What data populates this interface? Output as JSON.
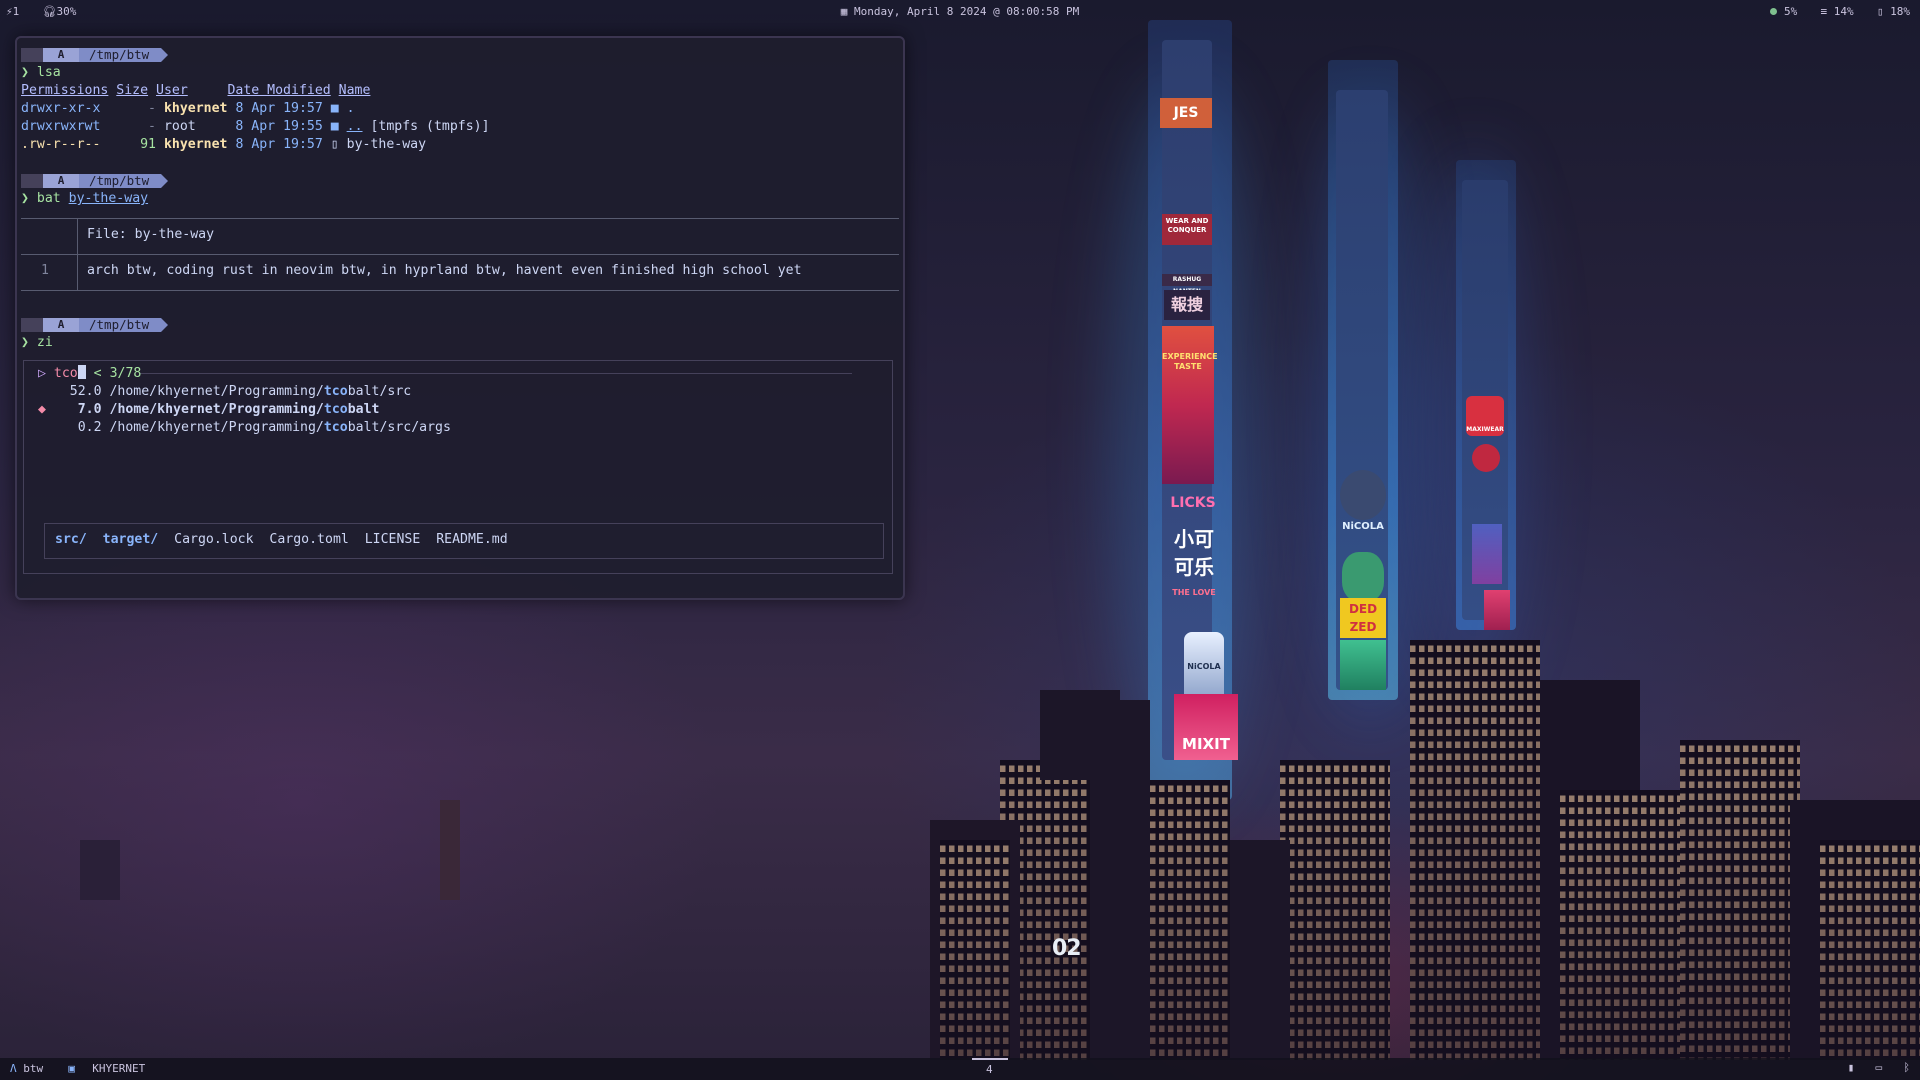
{
  "topbar": {
    "workspace": "1",
    "volume": "30%",
    "datetime": "Monday, April  8 2024 @ 08:00:58 PM",
    "cpu": "5%",
    "memory": "14%",
    "disk": "18%",
    "icons": [
      "volume-icon",
      "calendar-icon",
      "cpu-icon",
      "memory-icon",
      "disk-icon"
    ]
  },
  "terminal": {
    "prompt_path": "/tmp/btw",
    "prompt_logo": "A",
    "cmd1": "lsa",
    "ls_headers": [
      "Permissions",
      "Size",
      "User",
      "Date Modified",
      "Name"
    ],
    "ls_rows": [
      {
        "perm": "drwxr-xr-x",
        "size": "-",
        "user": "khyernet",
        "date": "8 Apr 19:57",
        "name": "."
      },
      {
        "perm": "drwxrwxrwt",
        "size": "-",
        "user": "root",
        "date": "8 Apr 19:55",
        "name": "..",
        "extra": "[tmpfs (tmpfs)]"
      },
      {
        "perm": ".rw-r--r--",
        "size": "91",
        "user": "khyernet",
        "date": "8 Apr 19:57",
        "name": "by-the-way"
      }
    ],
    "cmd2": "bat",
    "cmd2_arg": "by-the-way",
    "bat_file_label": "File: by-the-way",
    "bat_line_no": "1",
    "bat_line": "arch btw, coding rust in neovim btw, in hyprland btw, havent even finished high school yet",
    "cmd3": "zi",
    "zi_query": "tco",
    "zi_count": "3/78",
    "zi_results": [
      {
        "score": "52.0",
        "path_pre": "/home/khyernet/Programming/",
        "match": "tco",
        "path_post": "balt/src",
        "selected": false
      },
      {
        "score": "7.0",
        "path_pre": "/home/khyernet/Programming/",
        "match": "tco",
        "path_post": "balt",
        "selected": true
      },
      {
        "score": "0.2",
        "path_pre": "/home/khyernet/Programming/",
        "match": "tco",
        "path_post": "balt/src/args",
        "selected": false
      }
    ],
    "zi_files": [
      "src/",
      "target/",
      "Cargo.lock",
      "Cargo.toml",
      "LICENSE",
      "README.md"
    ]
  },
  "wallpaper": {
    "ads": [
      "JES",
      "WEAR AND CONQUER",
      "RASHUG NANTEN",
      "報捜",
      "EXPERIENCE TASTE",
      "LICKS",
      "小可可乐",
      "THE LOVE",
      "NiCOLA",
      "MIXIT",
      "NiCOLA",
      "DED ZED",
      "MAXIWEAR"
    ],
    "building_number": "02"
  },
  "bottombar": {
    "workspace_label": "btw",
    "user_label": "KHYERNET",
    "workspace_num": "4"
  }
}
